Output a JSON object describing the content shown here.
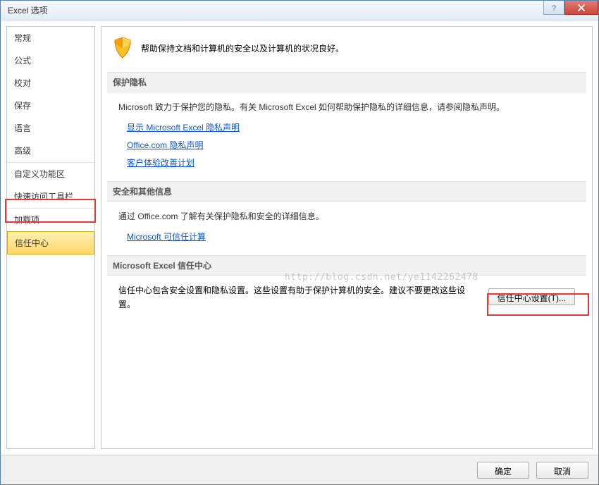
{
  "titlebar": {
    "title": "Excel 选项"
  },
  "sidebar": {
    "items": [
      {
        "label": "常规"
      },
      {
        "label": "公式"
      },
      {
        "label": "校对"
      },
      {
        "label": "保存"
      },
      {
        "label": "语言"
      },
      {
        "label": "高级"
      },
      {
        "label": "自定义功能区"
      },
      {
        "label": "快速访问工具栏"
      },
      {
        "label": "加载项"
      },
      {
        "label": "信任中心"
      }
    ]
  },
  "content": {
    "top_line": "帮助保持文档和计算机的安全以及计算机的状况良好。",
    "privacy_header": "保护隐私",
    "privacy_text": "Microsoft 致力于保护您的隐私。有关 Microsoft Excel 如何帮助保护隐私的详细信息，请参阅隐私声明。",
    "links": {
      "link1": "显示 Microsoft Excel 隐私声明",
      "link2": "Office.com 隐私声明",
      "link3": "客户体验改善计划"
    },
    "security_header": "安全和其他信息",
    "security_text": "通过 Office.com 了解有关保护隐私和安全的详细信息。",
    "link4": "Microsoft 可信任计算",
    "trust_header": "Microsoft Excel 信任中心",
    "trust_text": "信任中心包含安全设置和隐私设置。这些设置有助于保护计算机的安全。建议不要更改这些设置。",
    "trust_button": "信任中心设置(T)..."
  },
  "footer": {
    "ok": "确定",
    "cancel": "取消"
  },
  "watermark": "http://blog.csdn.net/ye1142262478"
}
